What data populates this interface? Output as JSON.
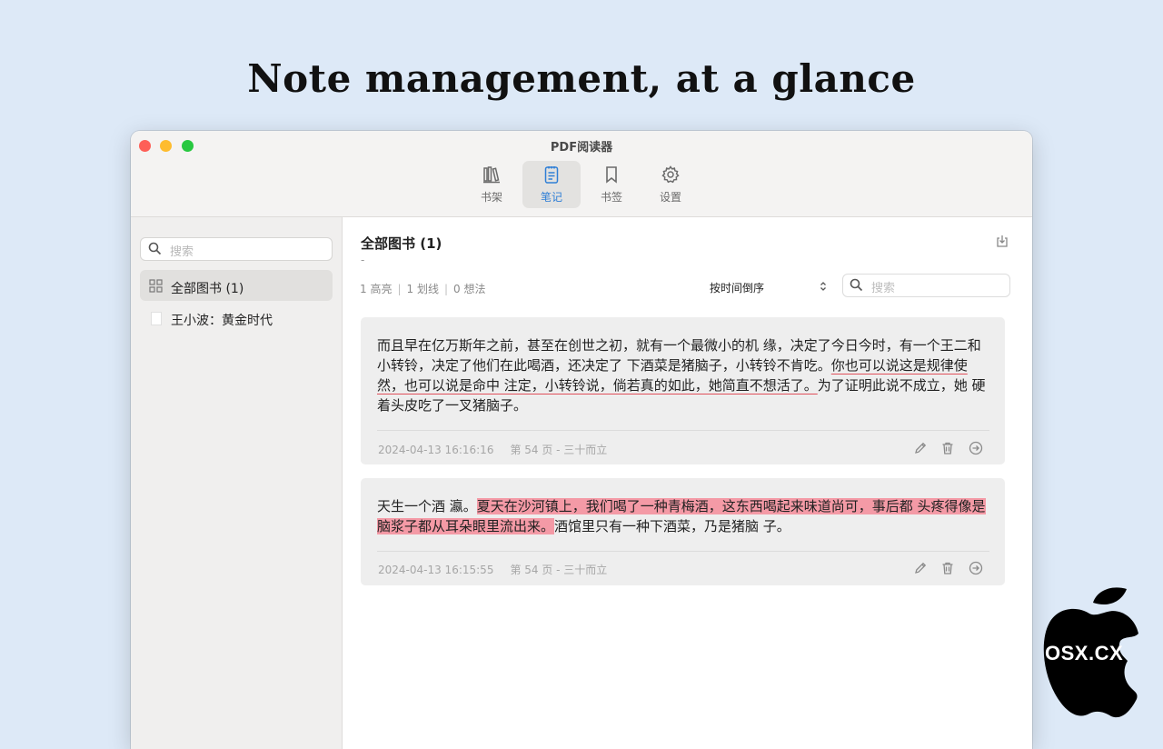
{
  "headline": "Note management, at a glance",
  "window": {
    "title": "PDF阅读器",
    "toolbar": [
      {
        "label": "书架",
        "icon": "bookshelf-icon"
      },
      {
        "label": "笔记",
        "icon": "notes-icon",
        "active": true
      },
      {
        "label": "书签",
        "icon": "bookmark-icon"
      },
      {
        "label": "设置",
        "icon": "settings-gear-icon"
      }
    ]
  },
  "sidebar": {
    "search_placeholder": "搜索",
    "all_books": "全部图书 (1)",
    "books": [
      "王小波：黄金时代"
    ]
  },
  "main": {
    "title": "全部图书 (1)",
    "dash": "-",
    "stats": {
      "highlights": "1 高亮",
      "underlines": "1 划线",
      "thoughts": "0 想法"
    },
    "sort_option": "按时间倒序",
    "search_placeholder": "搜索",
    "notes": [
      {
        "text_plain": "而且早在亿万斯年之前，甚至在创世之初，就有一个最微小的机 缘，决定了今日今时，有一个王二和小转铃，决定了他们在此喝酒，还决定了 下酒菜是猪脑子，小转铃不肯吃。",
        "text_underlined": "你也可以说这是规律使然，也可以说是命中 注定，小转铃说，倘若真的如此，她简直不想活了。",
        "text_after": "为了证明此说不成立，她 硬着头皮吃了一叉猪脑子。",
        "timestamp": "2024-04-13 16:16:16",
        "location": "第 54 页 - 三十而立"
      },
      {
        "text_before": "天生一个酒 瀛。",
        "text_highlighted": "夏天在沙河镇上，我们喝了一种青梅酒，这东西喝起来味道尚可，事后都 头疼得像是脑浆子都从耳朵眼里流出来。",
        "text_after": "酒馆里只有一种下酒菜，乃是猪脑 子。",
        "timestamp": "2024-04-13 16:15:55",
        "location": "第 54 页 - 三十而立"
      }
    ]
  },
  "colors": {
    "background": "#dde9f7",
    "accent": "#2f7fd6",
    "highlight": "#f49aa6",
    "underline": "#e04f5a"
  },
  "watermark": "OSX.CX"
}
